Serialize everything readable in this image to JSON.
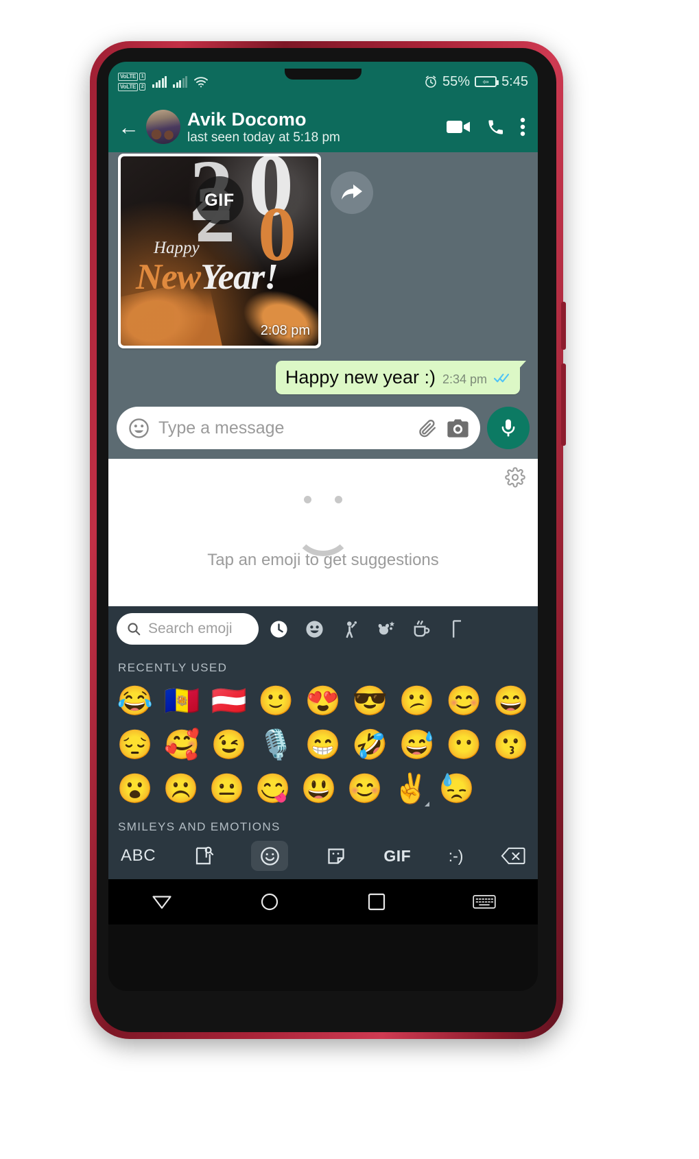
{
  "status_bar": {
    "volte_1": "VoLTE",
    "volte_1_num": "1",
    "volte_2": "VoLTE",
    "volte_2_num": "2",
    "battery_percent": "55%",
    "clock": "5:45",
    "alarm_icon": "alarm-clock-icon",
    "wifi_icon": "wifi-icon",
    "signal_icon": "signal-bars-icon"
  },
  "header": {
    "back_icon": "back-arrow-icon",
    "avatar": "contact-avatar",
    "contact_name": "Avik Docomo",
    "contact_status": "last seen today at 5:18 pm",
    "video_call_icon": "video-call-icon",
    "voice_call_icon": "phone-call-icon",
    "menu_icon": "overflow-menu-icon",
    "bg_color": "#0d6b5c"
  },
  "chat": {
    "background_color": "#5c6b72",
    "gif_message": {
      "badge": "GIF",
      "time": "2:08 pm",
      "art_happy": "Happy",
      "art_new": "New",
      "art_year": "Year!",
      "art_digit_2a": "2",
      "art_digit_0a": "0",
      "art_digit_2b": "2",
      "art_digit_0b": "0",
      "forward_icon": "forward-arrow-icon"
    },
    "outgoing_message": {
      "text": "Happy new year :)",
      "time": "2:34 pm",
      "ticks": "✓✓",
      "tick_color": "#4fc3f7",
      "bubble_color": "#dcf8c6"
    }
  },
  "input_bar": {
    "emoji_icon": "emoji-smiley-icon",
    "placeholder": "Type a message",
    "attach_icon": "paperclip-icon",
    "camera_icon": "camera-icon",
    "mic_icon": "microphone-icon",
    "mic_bg_color": "#0c7a63"
  },
  "suggestion_panel": {
    "text": "Tap an emoji to get suggestions",
    "gear_icon": "gear-icon",
    "face_icon": "smiley-outline-icon"
  },
  "emoji_keyboard": {
    "background_color": "#2b3740",
    "search_placeholder": "Search emoji",
    "search_icon": "search-icon",
    "categories": [
      {
        "name": "recent",
        "icon": "clock-icon",
        "active": true
      },
      {
        "name": "smileys",
        "icon": "smiley-icon",
        "active": false
      },
      {
        "name": "people",
        "icon": "person-waving-icon",
        "active": false
      },
      {
        "name": "animals-nature",
        "icon": "animal-plant-icon",
        "active": false
      },
      {
        "name": "food-drink",
        "icon": "coffee-cup-icon",
        "active": false
      },
      {
        "name": "activities",
        "icon": "activity-icon",
        "active": false
      }
    ],
    "section_recent": "RECENTLY USED",
    "section_smileys": "SMILEYS AND EMOTIONS",
    "rows": [
      [
        "😂",
        "🇦🇩",
        "🇦🇹",
        "🙂",
        "😍",
        "😎",
        "😕",
        "😊",
        "😄"
      ],
      [
        "😔",
        "🥰",
        "😉",
        "🎙️",
        "😁",
        "🤣",
        "😅",
        "😶",
        "😗"
      ],
      [
        "😮",
        "☹️",
        "😐",
        "😋",
        "😃",
        "😊",
        "✌️",
        "😓"
      ]
    ],
    "bottom_bar": {
      "abc_label": "ABC",
      "clipboard_icon": "clipboard-search-icon",
      "emoji_icon": "emoji-icon",
      "sticker_icon": "sticker-icon",
      "gif_label": "GIF",
      "kaomoji_label": ":-)",
      "backspace_icon": "backspace-icon"
    }
  },
  "nav_bar": {
    "back_icon": "nav-back-triangle-icon",
    "home_icon": "nav-home-circle-icon",
    "recents_icon": "nav-recents-square-icon",
    "keyboard_icon": "nav-keyboard-icon"
  }
}
